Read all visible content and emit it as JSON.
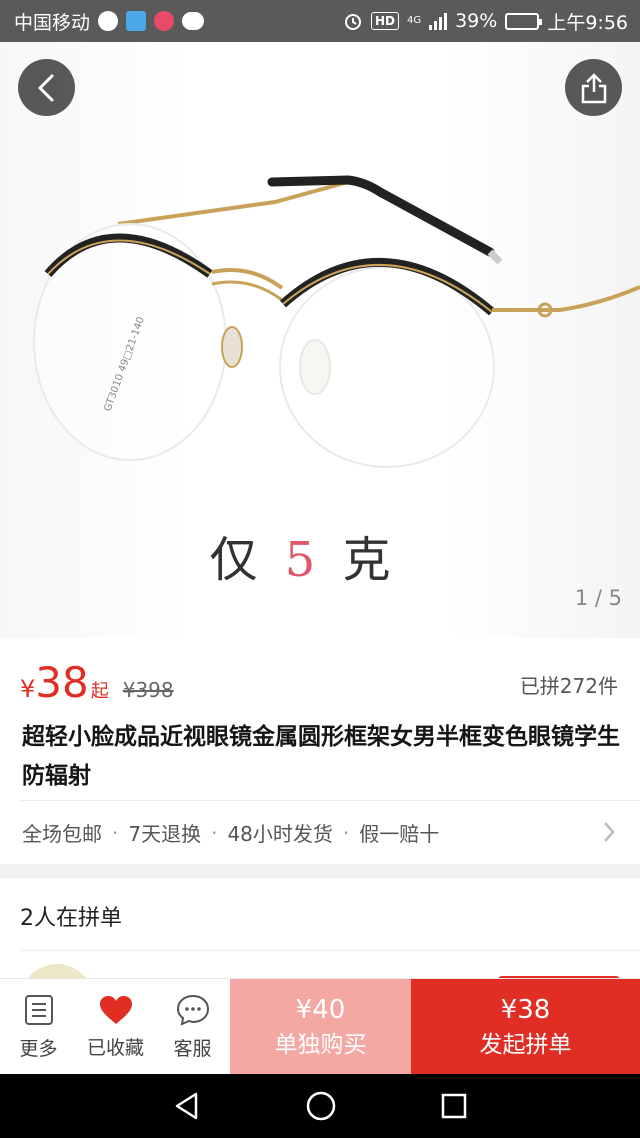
{
  "status_bar": {
    "carrier": "中国移动",
    "network": "4G",
    "hd": "HD",
    "battery": "39%",
    "battery_level": 0.39,
    "time": "上午9:56"
  },
  "gallery": {
    "caption_prefix": "仅",
    "caption_number": "5",
    "caption_suffix": "克",
    "pager": "1 / 5"
  },
  "product": {
    "currency": "¥",
    "price": "38",
    "price_suffix": "起",
    "original_price": "¥398",
    "sold": "已拼272件",
    "title": "超轻小脸成品近视眼镜金属圆形框架女男半框变色眼镜学生防辐射",
    "services": [
      "全场包邮",
      "7天退换",
      "48小时发货",
      "假一赔十"
    ],
    "service_separator": "·"
  },
  "group_buy": {
    "title": "2人在拼单"
  },
  "action_bar": {
    "more_label": "更多",
    "favorite_label": "已收藏",
    "service_label": "客服",
    "solo_price": "¥40",
    "solo_label": "单独购买",
    "group_price": "¥38",
    "group_label": "发起拼单"
  },
  "colors": {
    "accent": "#e02e24",
    "solo_button": "#f4a8a4",
    "status_bar": "#5a5a5a"
  },
  "icons": [
    "back-icon",
    "share-icon",
    "more-icon",
    "heart-icon",
    "customer-service-icon",
    "chevron-right-icon",
    "nav-back-icon",
    "nav-home-icon",
    "nav-recents-icon"
  ]
}
